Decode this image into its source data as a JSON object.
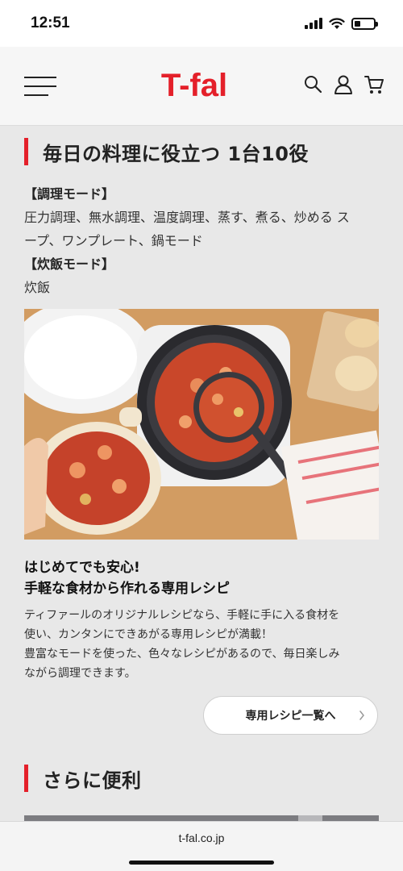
{
  "status_bar": {
    "time": "12:51",
    "battery_level": 0.3,
    "icons": [
      "signal-icon",
      "wifi-icon",
      "battery-icon"
    ]
  },
  "header": {
    "logo_text": "T-fal",
    "brand_color": "#e4202a",
    "icons": [
      "menu-icon",
      "search-icon",
      "account-icon",
      "cart-icon"
    ]
  },
  "section1": {
    "heading": "毎日の料理に役立つ 1台10役",
    "cooking_mode_title": "【調理モード】",
    "cooking_mode_text_line1": "圧力調理、無水調理、温度調理、蒸す、煮る、炒める ス",
    "cooking_mode_text_line2": "ープ、ワンプレート、鍋モード",
    "rice_mode_title": "【炊飯モード】",
    "rice_mode_text": "炊飯",
    "subheading_line1": "はじめてでも安心!",
    "subheading_line2": "手軽な食材から作れる専用レシピ",
    "body_line1": "ティファールのオリジナルレシピなら、手軽に手に入る食材を",
    "body_line2": "使い、カンタンにできあがる専用レシピが満載！",
    "body_line3": "豊富なモードを使った、色々なレシピがあるので、毎日楽しみ",
    "body_line4": "ながら調理できます。",
    "button_label": "専用レシピ一覧へ"
  },
  "section2": {
    "heading": "さらに便利"
  },
  "browser": {
    "url": "t-fal.co.jp"
  }
}
